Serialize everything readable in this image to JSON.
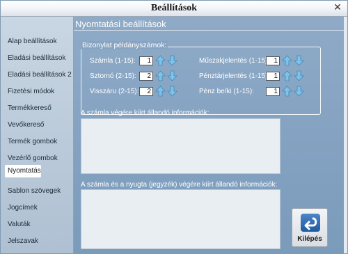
{
  "window": {
    "title": "Beállítások",
    "close_glyph": "✕"
  },
  "sidebar": {
    "items": [
      {
        "label": "Alap beállítások"
      },
      {
        "label": "Eladási beállítások"
      },
      {
        "label": "Eladási beállítások 2"
      },
      {
        "label": "Fizetési módok"
      },
      {
        "label": "Termékkereső"
      },
      {
        "label": "Vevőkereső"
      },
      {
        "label": "Termék gombok"
      },
      {
        "label": "Vezérlő gombok"
      },
      {
        "label": "Nyomtatás",
        "active": true
      },
      {
        "label": "Sablon szövegek"
      },
      {
        "label": "Jogcímek"
      },
      {
        "label": "Valuták"
      },
      {
        "label": "Jelszavak"
      }
    ]
  },
  "main": {
    "title": "Nyomtatási beállítások",
    "copies_group": {
      "title": "Bizonylat példányszámok:",
      "fields": [
        {
          "label": "Számla (1-15):",
          "value": "1"
        },
        {
          "label": "Sztornó (2-15):",
          "value": "2"
        },
        {
          "label": "Visszáru (2-15):",
          "value": "2"
        },
        {
          "label": "Műszakjelentés (1-15):",
          "value": "1"
        },
        {
          "label": "Pénztárjelentés (1-15):",
          "value": "1"
        },
        {
          "label": "Pénz be/ki (1-15):",
          "value": "1"
        }
      ]
    },
    "invoice_footer_label": "A számla végére kiírt állandó információk:",
    "invoice_receipt_footer_label": "A számla és a nyugta (jegyzék) végére kiírt állandó információk:",
    "exit_button": {
      "label": "Kilépés",
      "icon": "back-arrow-icon"
    }
  },
  "colors": {
    "accent": "#1e5aa0",
    "panel": "#87a5c3",
    "sidebar": "#bccbdb"
  }
}
